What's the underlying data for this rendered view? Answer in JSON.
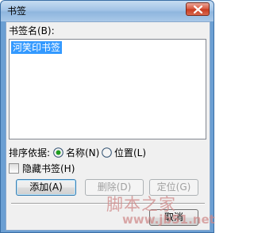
{
  "window": {
    "title": "书签"
  },
  "bookmark_name": {
    "label": "书签名(B):",
    "selected_item": "河笑印书签"
  },
  "sort_by": {
    "label": "排序依据:",
    "options": [
      {
        "label": "名称(N)",
        "selected": true
      },
      {
        "label": "位置(L)",
        "selected": false
      }
    ]
  },
  "hidden_bookmarks": {
    "label": "隐藏书签(H)",
    "checked": false
  },
  "buttons": {
    "add": "添加(A)",
    "delete": "删除(D)",
    "goto": "定位(G)",
    "cancel": "取消"
  },
  "watermark": {
    "text": "脚本之家",
    "url": "www.jb51.net"
  },
  "colors": {
    "selection": "#3399ff",
    "title_gradient_start": "#c6dcf2",
    "close_button": "#d8563d",
    "dialog_background": "#f0f0f0"
  }
}
